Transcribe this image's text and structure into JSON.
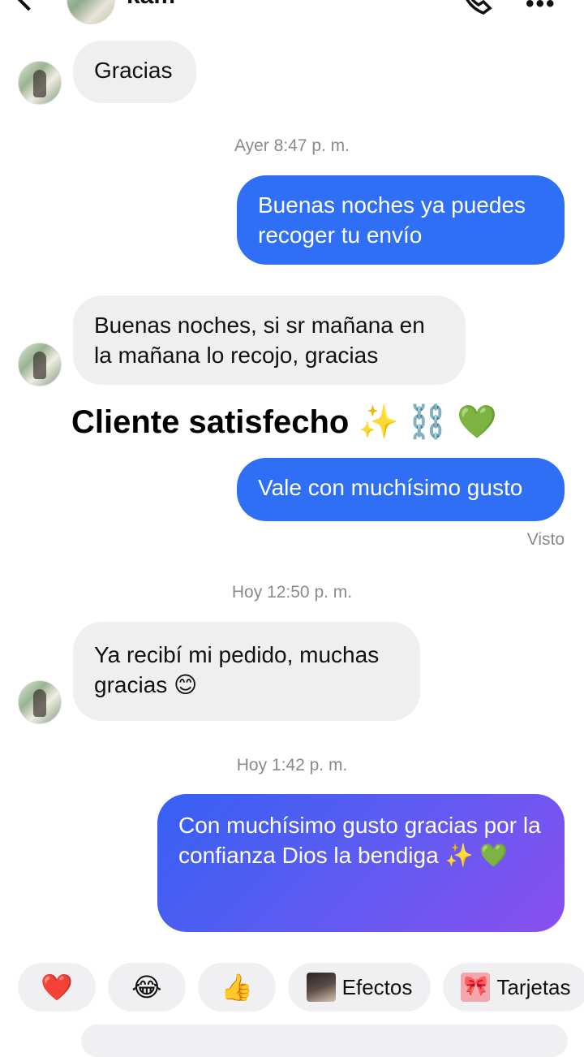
{
  "header": {
    "contact_name": "kam",
    "icons": [
      "back-chevron-icon",
      "phone-icon",
      "more-icon"
    ]
  },
  "messages": [
    {
      "direction": "in",
      "text": "Gracias"
    },
    {
      "type": "timestamp",
      "text": "Ayer 8:47 p. m."
    },
    {
      "direction": "out",
      "text": "Buenas noches ya puedes recoger tu envío"
    },
    {
      "direction": "in",
      "text": "Buenas noches, si sr mañana en la mañana lo recojo, gracias"
    },
    {
      "direction": "out",
      "text": "Vale con muchísimo gusto"
    },
    {
      "type": "status",
      "text": "Visto"
    },
    {
      "type": "timestamp",
      "text": "Hoy 12:50 p. m."
    },
    {
      "direction": "in",
      "text": "Ya recibí mi pedido, muchas gracias 😊"
    },
    {
      "type": "timestamp",
      "text": "Hoy 1:42 p. m."
    },
    {
      "direction": "out",
      "text": "Con muchísimo gusto gracias por la confianza Dios la bendiga ✨ 💚"
    }
  ],
  "overlay": {
    "caption": "Cliente satisfecho ✨ ⛓️ 💚"
  },
  "quick_replies": {
    "heart": "❤️",
    "laugh": "😂",
    "thumbs": "👍",
    "effects_label": "Efectos",
    "cards_label": "Tarjetas"
  },
  "colors": {
    "outgoing": "#2f6ff5",
    "incoming": "#efeff0",
    "gradient_end": "#8a4ff0",
    "meta_text": "#8a8a8e"
  }
}
